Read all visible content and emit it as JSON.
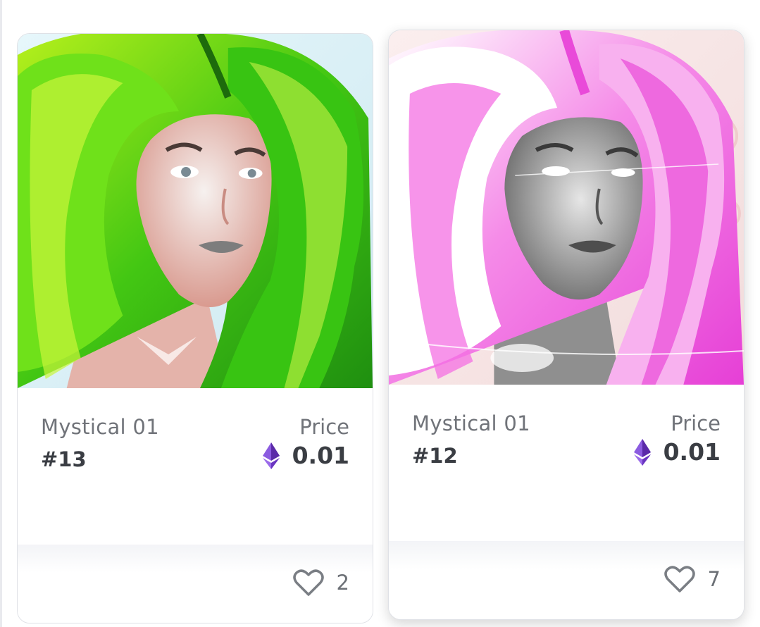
{
  "cards": [
    {
      "collection": "Mystical 01",
      "token_id": "#13",
      "price_label": "Price",
      "price": "0.01",
      "likes": "2",
      "hair_color": "#5fd80e",
      "hair_highlight": "#d8f542",
      "background_color": "#dff3f8"
    },
    {
      "collection": "Mystical 01",
      "token_id": "#12",
      "price_label": "Price",
      "price": "0.01",
      "likes": "7",
      "hair_color": "#f04ddf",
      "hair_highlight": "#ffffff",
      "background_color": "#f7e4e4"
    }
  ],
  "colors": {
    "eth_light": "#9b6bea",
    "eth_dark": "#5b2aa8",
    "text_dark": "#3a3d43",
    "text_muted": "#707379"
  },
  "icons": {
    "currency": "ethereum-icon",
    "like": "heart-outline-icon"
  }
}
